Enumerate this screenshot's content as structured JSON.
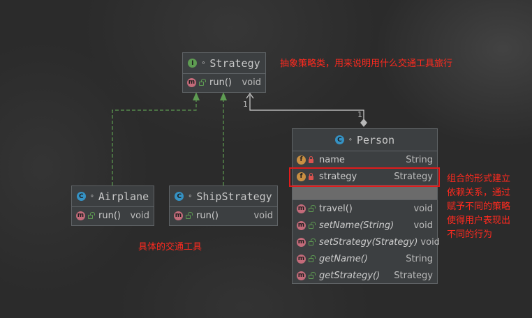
{
  "strategy": {
    "title": "Strategy",
    "badge": "I",
    "methods": [
      {
        "badge": "m",
        "name": "run()",
        "type": "void"
      }
    ]
  },
  "airplane": {
    "title": "Airplane",
    "badge": "C",
    "methods": [
      {
        "badge": "m",
        "name": "run()",
        "type": "void"
      }
    ]
  },
  "ship": {
    "title": "ShipStrategy",
    "badge": "C",
    "methods": [
      {
        "badge": "m",
        "name": "run()",
        "type": "void"
      }
    ]
  },
  "person": {
    "title": "Person",
    "badge": "C",
    "fields": [
      {
        "badge": "f",
        "name": "name",
        "type": "String"
      },
      {
        "badge": "f",
        "name": "strategy",
        "type": "Strategy"
      }
    ],
    "methods": [
      {
        "badge": "m",
        "name": "travel()",
        "type": "void"
      },
      {
        "badge": "m",
        "name": "setName(String)",
        "type": "void"
      },
      {
        "badge": "m",
        "name": "setStrategy(Strategy)",
        "type": "void"
      },
      {
        "badge": "m",
        "name": "getName()",
        "type": "String"
      },
      {
        "badge": "m",
        "name": "getStrategy()",
        "type": "Strategy"
      }
    ]
  },
  "multiplicity": {
    "strategy_end": "1",
    "person_end": "1"
  },
  "notes": {
    "abstract": "抽象策略类，用来说明用什么交通工具旅行",
    "concrete": "具体的交通工具",
    "composition": [
      "组合的形式建立",
      "依赖关系，通过",
      "赋予不同的策略",
      "使得用户表现出",
      "不同的行为"
    ]
  },
  "colors": {
    "annotation": "#ff2a1f",
    "highlight": "#e01b1b",
    "interface_badge": "#5e9c52",
    "class_badge": "#3592c4",
    "method_badge": "#c36b7a",
    "field_badge": "#c98f42"
  }
}
